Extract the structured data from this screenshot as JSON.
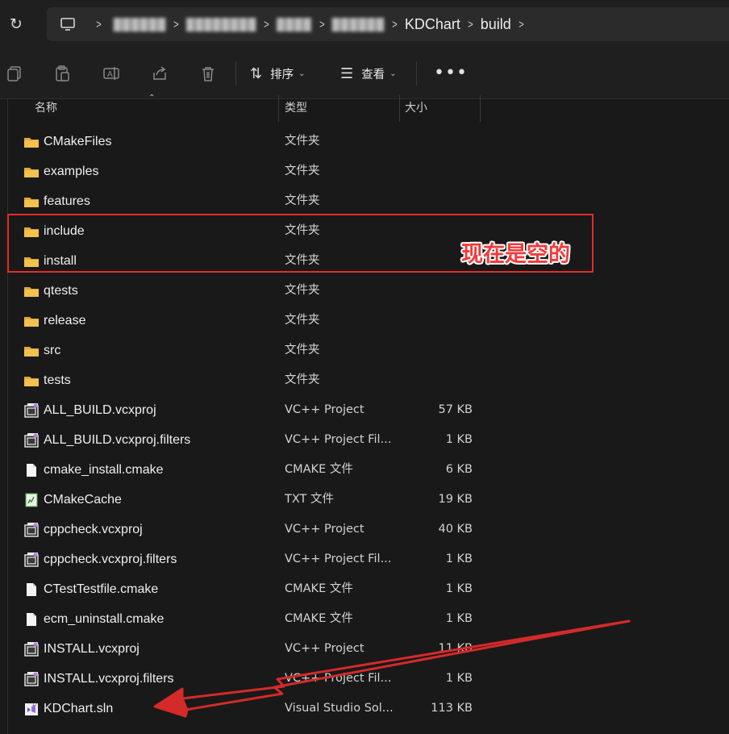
{
  "address_bar": {
    "hidden_crumbs": [
      "██████",
      "████████",
      "████",
      "█",
      "██████"
    ],
    "crumbs": [
      "KDChart",
      "build"
    ]
  },
  "toolbar": {
    "sort_label": "排序",
    "view_label": "查看",
    "more_label": "•••"
  },
  "columns": {
    "name": "名称",
    "type": "类型",
    "size": "大小"
  },
  "files": [
    {
      "name": "CMakeFiles",
      "type": "文件夹",
      "size": "",
      "icon": "folder-icon"
    },
    {
      "name": "examples",
      "type": "文件夹",
      "size": "",
      "icon": "folder-icon"
    },
    {
      "name": "features",
      "type": "文件夹",
      "size": "",
      "icon": "folder-icon"
    },
    {
      "name": "include",
      "type": "文件夹",
      "size": "",
      "icon": "folder-icon"
    },
    {
      "name": "install",
      "type": "文件夹",
      "size": "",
      "icon": "folder-icon"
    },
    {
      "name": "qtests",
      "type": "文件夹",
      "size": "",
      "icon": "folder-icon"
    },
    {
      "name": "release",
      "type": "文件夹",
      "size": "",
      "icon": "folder-icon"
    },
    {
      "name": "src",
      "type": "文件夹",
      "size": "",
      "icon": "folder-icon"
    },
    {
      "name": "tests",
      "type": "文件夹",
      "size": "",
      "icon": "folder-icon"
    },
    {
      "name": "ALL_BUILD.vcxproj",
      "type": "VC++ Project",
      "size": "57 KB",
      "icon": "vcxproj-icon"
    },
    {
      "name": "ALL_BUILD.vcxproj.filters",
      "type": "VC++ Project Fil...",
      "size": "1 KB",
      "icon": "vcxproj-icon"
    },
    {
      "name": "cmake_install.cmake",
      "type": "CMAKE 文件",
      "size": "6 KB",
      "icon": "file-icon"
    },
    {
      "name": "CMakeCache",
      "type": "TXT 文件",
      "size": "19 KB",
      "icon": "text-file-icon"
    },
    {
      "name": "cppcheck.vcxproj",
      "type": "VC++ Project",
      "size": "40 KB",
      "icon": "vcxproj-icon"
    },
    {
      "name": "cppcheck.vcxproj.filters",
      "type": "VC++ Project Fil...",
      "size": "1 KB",
      "icon": "vcxproj-icon"
    },
    {
      "name": "CTestTestfile.cmake",
      "type": "CMAKE 文件",
      "size": "1 KB",
      "icon": "file-icon"
    },
    {
      "name": "ecm_uninstall.cmake",
      "type": "CMAKE 文件",
      "size": "1 KB",
      "icon": "file-icon"
    },
    {
      "name": "INSTALL.vcxproj",
      "type": "VC++ Project",
      "size": "11 KB",
      "icon": "vcxproj-icon"
    },
    {
      "name": "INSTALL.vcxproj.filters",
      "type": "VC++ Project Fil...",
      "size": "1 KB",
      "icon": "vcxproj-icon"
    },
    {
      "name": "KDChart.sln",
      "type": "Visual Studio Sol...",
      "size": "113 KB",
      "icon": "sln-icon"
    }
  ],
  "annotation": {
    "text": "现在是空的",
    "color": "#e32b2b"
  },
  "colors": {
    "background": "#191919",
    "folder": "#f2c14e",
    "annotation": "#e32b2b"
  }
}
